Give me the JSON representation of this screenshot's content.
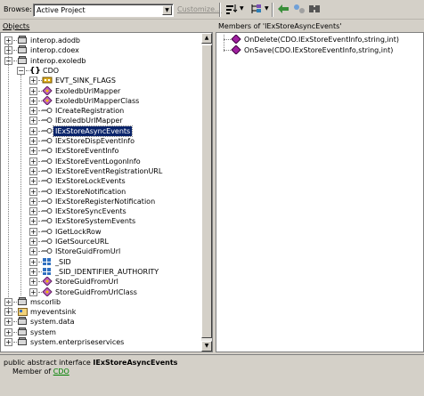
{
  "toolbar": {
    "browse_label": "Browse:",
    "browse_value": "Active Project",
    "customize_label": "Customize..."
  },
  "objects_panel": {
    "title": "Objects",
    "tree": [
      {
        "label": "interop.adodb",
        "icon": "assembly-icon",
        "expander": "+"
      },
      {
        "label": "interop.cdoex",
        "icon": "assembly-icon",
        "expander": "+"
      },
      {
        "label": "interop.exoledb",
        "icon": "assembly-icon",
        "expander": "-"
      },
      {
        "label": "CDO",
        "icon": "namespace-icon",
        "expander": "-"
      },
      {
        "label": "EVT_SINK_FLAGS",
        "icon": "enum-icon",
        "expander": "+"
      },
      {
        "label": "ExoledbUrlMapper",
        "icon": "class-icon",
        "expander": "+"
      },
      {
        "label": "ExoledbUrlMapperClass",
        "icon": "class-icon",
        "expander": "+"
      },
      {
        "label": "ICreateRegistration",
        "icon": "interface-icon",
        "expander": "+"
      },
      {
        "label": "IExoledbUrlMapper",
        "icon": "interface-icon",
        "expander": "+"
      },
      {
        "label": "IExStoreAsyncEvents",
        "icon": "interface-icon",
        "expander": "+",
        "selected": true
      },
      {
        "label": "IExStoreDispEventInfo",
        "icon": "interface-icon",
        "expander": "+"
      },
      {
        "label": "IExStoreEventInfo",
        "icon": "interface-icon",
        "expander": "+"
      },
      {
        "label": "IExStoreEventLogonInfo",
        "icon": "interface-icon",
        "expander": "+"
      },
      {
        "label": "IExStoreEventRegistrationURL",
        "icon": "interface-icon",
        "expander": "+"
      },
      {
        "label": "IExStoreLockEvents",
        "icon": "interface-icon",
        "expander": "+"
      },
      {
        "label": "IExStoreNotification",
        "icon": "interface-icon",
        "expander": "+"
      },
      {
        "label": "IExStoreRegisterNotification",
        "icon": "interface-icon",
        "expander": "+"
      },
      {
        "label": "IExStoreSyncEvents",
        "icon": "interface-icon",
        "expander": "+"
      },
      {
        "label": "IExStoreSystemEvents",
        "icon": "interface-icon",
        "expander": "+"
      },
      {
        "label": "IGetLockRow",
        "icon": "interface-icon",
        "expander": "+"
      },
      {
        "label": "IGetSourceURL",
        "icon": "interface-icon",
        "expander": "+"
      },
      {
        "label": "IStoreGuidFromUrl",
        "icon": "interface-icon",
        "expander": "+"
      },
      {
        "label": "_SID",
        "icon": "struct-icon",
        "expander": "+"
      },
      {
        "label": "_SID_IDENTIFIER_AUTHORITY",
        "icon": "struct-icon",
        "expander": "+"
      },
      {
        "label": "StoreGuidFromUrl",
        "icon": "class-icon",
        "expander": "+"
      },
      {
        "label": "StoreGuidFromUrlClass",
        "icon": "class-icon",
        "expander": "+"
      },
      {
        "label": "mscorlib",
        "icon": "assembly-icon",
        "expander": "+"
      },
      {
        "label": "myeventsink",
        "icon": "project-icon",
        "expander": "+"
      },
      {
        "label": "system.data",
        "icon": "assembly-icon",
        "expander": "+"
      },
      {
        "label": "system",
        "icon": "assembly-icon",
        "expander": "+"
      },
      {
        "label": "system.enterpriseservices",
        "icon": "assembly-icon",
        "expander": "+"
      }
    ]
  },
  "members_panel": {
    "title": "Members of 'IExStoreAsyncEvents'",
    "items": [
      {
        "label": "OnDelete(CDO.IExStoreEventInfo,string,int)",
        "icon": "method-icon"
      },
      {
        "label": "OnSave(CDO.IExStoreEventInfo,string,int)",
        "icon": "method-icon"
      }
    ]
  },
  "description": {
    "prefix": "public abstract interface ",
    "name": "IExStoreAsyncEvents",
    "member_of_label": "Member of ",
    "member_of_link": "CDO"
  },
  "colors": {
    "selection": "#0a246a",
    "method_icon": "#8b1a8b",
    "link": "#008000"
  }
}
